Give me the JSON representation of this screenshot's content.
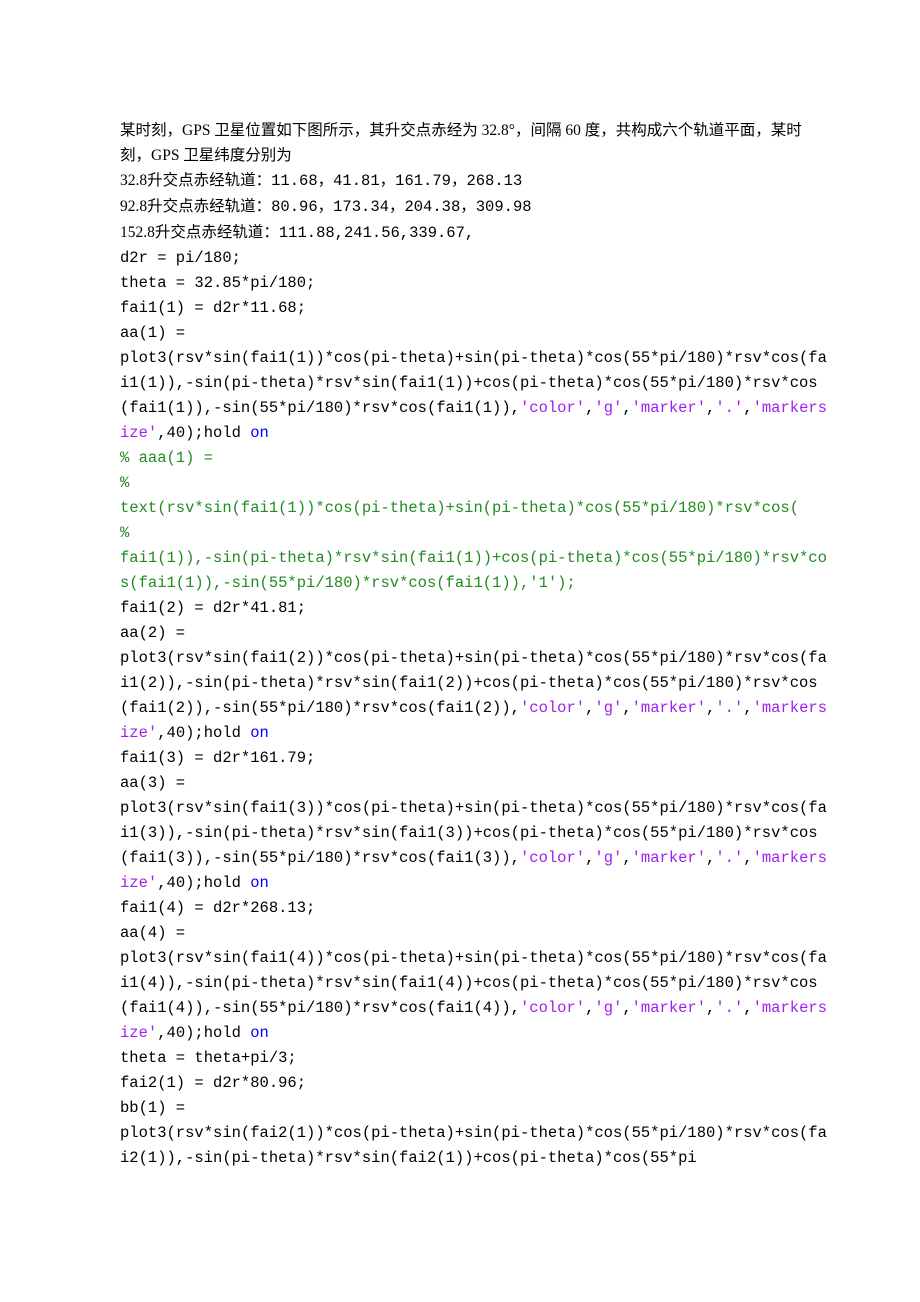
{
  "para": {
    "l1": "某时刻，GPS 卫星位置如下图所示，其升交点赤经为 32.8°，间隔 60 度，共构成六个轨道平面，某时刻，GPS 卫星纬度分别为",
    "l2_pre": "32.8",
    "l2_post": "升交点赤经轨道：11.68，41.81，161.79，268.13",
    "l3_pre": "92.8",
    "l3_post": "升交点赤经轨道：80.96，173.34，204.38，309.98",
    "l4_pre": "152.8",
    "l4_post": "升交点赤经轨道：111.88,241.56,339.67,"
  },
  "code": {
    "l01": "d2r = pi/180;",
    "l02": "theta = 32.85*pi/180;",
    "l03": "fai1(1) = d2r*11.68;",
    "l04": "aa(1) = ",
    "l05a": "plot3(rsv*sin(fai1(1))*cos(pi-theta)+sin(pi-theta)*cos(55*pi/180)*rsv*cos(fai1(1)),-sin(pi-theta)*rsv*sin(fai1(1))+cos(pi-theta)*cos(55*pi/180)*rsv*cos(fai1(1)),-sin(55*pi/180)*rsv*cos(fai1(1)),",
    "l05b": "'color'",
    "l05c": ",",
    "l05d": "'g'",
    "l05e": ",",
    "l05f": "'marker'",
    "l05g": ",",
    "l05h": "'.'",
    "l05i": ",",
    "l05j": "'markersize'",
    "l05k": ",40);hold ",
    "l05l": "on",
    "l06": "% aaa(1) = ",
    "l07": "% ",
    "l08": "text(rsv*sin(fai1(1))*cos(pi-theta)+sin(pi-theta)*cos(55*pi/180)*rsv*cos(",
    "l09": "% ",
    "l10": "fai1(1)),-sin(pi-theta)*rsv*sin(fai1(1))+cos(pi-theta)*cos(55*pi/180)*rsv*cos(fai1(1)),-sin(55*pi/180)*rsv*cos(fai1(1)),'1');",
    "l11": "fai1(2) = d2r*41.81;",
    "l12": "aa(2) = ",
    "l13a": "plot3(rsv*sin(fai1(2))*cos(pi-theta)+sin(pi-theta)*cos(55*pi/180)*rsv*cos(fai1(2)),-sin(pi-theta)*rsv*sin(fai1(2))+cos(pi-theta)*cos(55*pi/180)*rsv*cos(fai1(2)),-sin(55*pi/180)*rsv*cos(fai1(2)),",
    "l14": "fai1(3) = d2r*161.79;",
    "l15": "aa(3) = ",
    "l16a": "plot3(rsv*sin(fai1(3))*cos(pi-theta)+sin(pi-theta)*cos(55*pi/180)*rsv*cos(fai1(3)),-sin(pi-theta)*rsv*sin(fai1(3))+cos(pi-theta)*cos(55*pi/180)*rsv*cos(fai1(3)),-sin(55*pi/180)*rsv*cos(fai1(3)),",
    "l17": "fai1(4) = d2r*268.13;",
    "l18": "aa(4) = ",
    "l19a": "plot3(rsv*sin(fai1(4))*cos(pi-theta)+sin(pi-theta)*cos(55*pi/180)*rsv*cos(fai1(4)),-sin(pi-theta)*rsv*sin(fai1(4))+cos(pi-theta)*cos(55*pi/180)*rsv*cos(fai1(4)),-sin(55*pi/180)*rsv*cos(fai1(4)),",
    "blank": "",
    "l20": "theta = theta+pi/3;",
    "l21": "fai2(1) = d2r*80.96;",
    "l22": "bb(1) = ",
    "l23": "plot3(rsv*sin(fai2(1))*cos(pi-theta)+sin(pi-theta)*cos(55*pi/180)*rsv*cos(fai2(1)),-sin(pi-theta)*rsv*sin(fai2(1))+cos(pi-theta)*cos(55*pi"
  }
}
